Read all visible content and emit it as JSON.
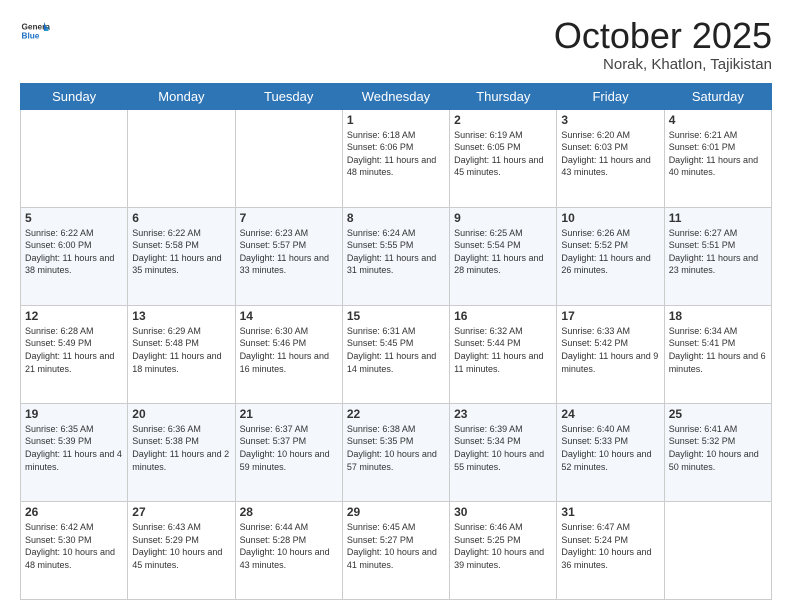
{
  "header": {
    "logo_general": "General",
    "logo_blue": "Blue",
    "month_title": "October 2025",
    "location": "Norak, Khatlon, Tajikistan"
  },
  "days_of_week": [
    "Sunday",
    "Monday",
    "Tuesday",
    "Wednesday",
    "Thursday",
    "Friday",
    "Saturday"
  ],
  "weeks": [
    [
      {
        "day": "",
        "info": ""
      },
      {
        "day": "",
        "info": ""
      },
      {
        "day": "",
        "info": ""
      },
      {
        "day": "1",
        "info": "Sunrise: 6:18 AM\nSunset: 6:06 PM\nDaylight: 11 hours and 48 minutes."
      },
      {
        "day": "2",
        "info": "Sunrise: 6:19 AM\nSunset: 6:05 PM\nDaylight: 11 hours and 45 minutes."
      },
      {
        "day": "3",
        "info": "Sunrise: 6:20 AM\nSunset: 6:03 PM\nDaylight: 11 hours and 43 minutes."
      },
      {
        "day": "4",
        "info": "Sunrise: 6:21 AM\nSunset: 6:01 PM\nDaylight: 11 hours and 40 minutes."
      }
    ],
    [
      {
        "day": "5",
        "info": "Sunrise: 6:22 AM\nSunset: 6:00 PM\nDaylight: 11 hours and 38 minutes."
      },
      {
        "day": "6",
        "info": "Sunrise: 6:22 AM\nSunset: 5:58 PM\nDaylight: 11 hours and 35 minutes."
      },
      {
        "day": "7",
        "info": "Sunrise: 6:23 AM\nSunset: 5:57 PM\nDaylight: 11 hours and 33 minutes."
      },
      {
        "day": "8",
        "info": "Sunrise: 6:24 AM\nSunset: 5:55 PM\nDaylight: 11 hours and 31 minutes."
      },
      {
        "day": "9",
        "info": "Sunrise: 6:25 AM\nSunset: 5:54 PM\nDaylight: 11 hours and 28 minutes."
      },
      {
        "day": "10",
        "info": "Sunrise: 6:26 AM\nSunset: 5:52 PM\nDaylight: 11 hours and 26 minutes."
      },
      {
        "day": "11",
        "info": "Sunrise: 6:27 AM\nSunset: 5:51 PM\nDaylight: 11 hours and 23 minutes."
      }
    ],
    [
      {
        "day": "12",
        "info": "Sunrise: 6:28 AM\nSunset: 5:49 PM\nDaylight: 11 hours and 21 minutes."
      },
      {
        "day": "13",
        "info": "Sunrise: 6:29 AM\nSunset: 5:48 PM\nDaylight: 11 hours and 18 minutes."
      },
      {
        "day": "14",
        "info": "Sunrise: 6:30 AM\nSunset: 5:46 PM\nDaylight: 11 hours and 16 minutes."
      },
      {
        "day": "15",
        "info": "Sunrise: 6:31 AM\nSunset: 5:45 PM\nDaylight: 11 hours and 14 minutes."
      },
      {
        "day": "16",
        "info": "Sunrise: 6:32 AM\nSunset: 5:44 PM\nDaylight: 11 hours and 11 minutes."
      },
      {
        "day": "17",
        "info": "Sunrise: 6:33 AM\nSunset: 5:42 PM\nDaylight: 11 hours and 9 minutes."
      },
      {
        "day": "18",
        "info": "Sunrise: 6:34 AM\nSunset: 5:41 PM\nDaylight: 11 hours and 6 minutes."
      }
    ],
    [
      {
        "day": "19",
        "info": "Sunrise: 6:35 AM\nSunset: 5:39 PM\nDaylight: 11 hours and 4 minutes."
      },
      {
        "day": "20",
        "info": "Sunrise: 6:36 AM\nSunset: 5:38 PM\nDaylight: 11 hours and 2 minutes."
      },
      {
        "day": "21",
        "info": "Sunrise: 6:37 AM\nSunset: 5:37 PM\nDaylight: 10 hours and 59 minutes."
      },
      {
        "day": "22",
        "info": "Sunrise: 6:38 AM\nSunset: 5:35 PM\nDaylight: 10 hours and 57 minutes."
      },
      {
        "day": "23",
        "info": "Sunrise: 6:39 AM\nSunset: 5:34 PM\nDaylight: 10 hours and 55 minutes."
      },
      {
        "day": "24",
        "info": "Sunrise: 6:40 AM\nSunset: 5:33 PM\nDaylight: 10 hours and 52 minutes."
      },
      {
        "day": "25",
        "info": "Sunrise: 6:41 AM\nSunset: 5:32 PM\nDaylight: 10 hours and 50 minutes."
      }
    ],
    [
      {
        "day": "26",
        "info": "Sunrise: 6:42 AM\nSunset: 5:30 PM\nDaylight: 10 hours and 48 minutes."
      },
      {
        "day": "27",
        "info": "Sunrise: 6:43 AM\nSunset: 5:29 PM\nDaylight: 10 hours and 45 minutes."
      },
      {
        "day": "28",
        "info": "Sunrise: 6:44 AM\nSunset: 5:28 PM\nDaylight: 10 hours and 43 minutes."
      },
      {
        "day": "29",
        "info": "Sunrise: 6:45 AM\nSunset: 5:27 PM\nDaylight: 10 hours and 41 minutes."
      },
      {
        "day": "30",
        "info": "Sunrise: 6:46 AM\nSunset: 5:25 PM\nDaylight: 10 hours and 39 minutes."
      },
      {
        "day": "31",
        "info": "Sunrise: 6:47 AM\nSunset: 5:24 PM\nDaylight: 10 hours and 36 minutes."
      },
      {
        "day": "",
        "info": ""
      }
    ]
  ]
}
